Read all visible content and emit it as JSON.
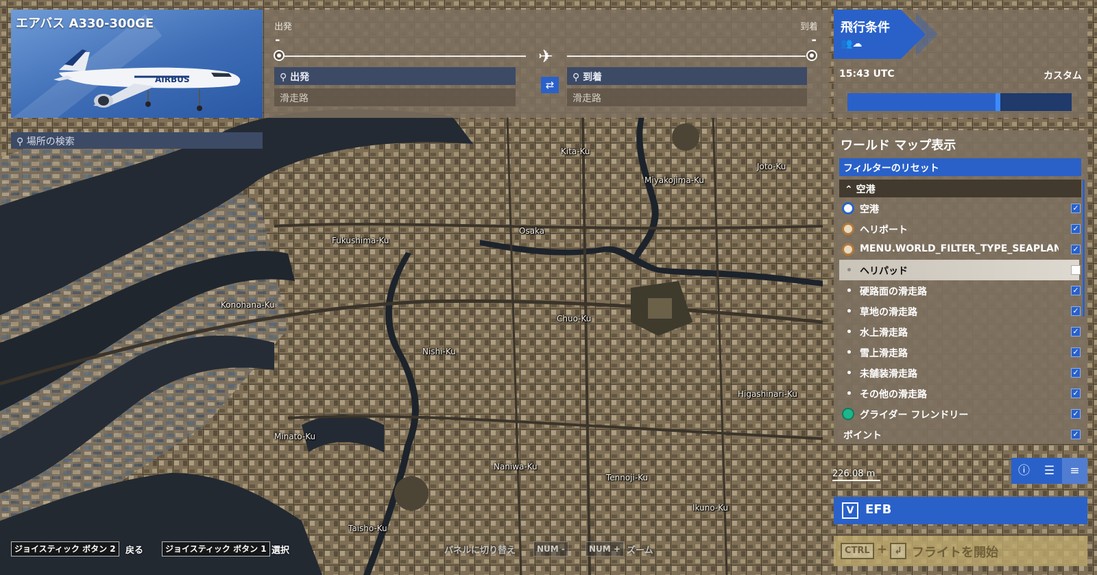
{
  "map": {
    "labels": [
      "Kita-Ku",
      "Joto-Ku",
      "Miyakojima-Ku",
      "Osaka",
      "Fukushima-Ku",
      "Konohana-Ku",
      "Chuo-Ku",
      "Nishi-Ku",
      "Higashinari-Ku",
      "Minato-Ku",
      "Naniwa-Ku",
      "Tennoji-Ku",
      "Ikuno-Ku",
      "Taisho-Ku"
    ],
    "scale": "226.08 m"
  },
  "aircraft": {
    "title": "エアバス A330-300GE"
  },
  "route": {
    "departure_label": "出発",
    "arrival_label": "到着",
    "departure_value": "-",
    "arrival_value": "-",
    "departure_search": "出発",
    "arrival_search": "到着",
    "departure_runway": "滑走路",
    "arrival_runway": "滑走路",
    "swap_icon": "swap-arrows",
    "plane_icon": "airplane"
  },
  "conditions": {
    "title": "飛行条件",
    "icons": "👥☁",
    "time": "15:43 UTC",
    "preset": "カスタム",
    "time_of_day_fraction": 0.66
  },
  "location_search": {
    "placeholder": "場所の検索"
  },
  "filter": {
    "title": "ワールド マップ表示",
    "reset": "フィルターのリセット",
    "group": "空港",
    "items": [
      {
        "label": "空港",
        "icon": "airport-icon",
        "checked": true
      },
      {
        "label": "ヘリポート",
        "icon": "heliport-icon",
        "checked": true
      },
      {
        "label": "MENU.WORLD_FILTER_TYPE_SEAPLANE_BASE",
        "icon": "seaplane-icon",
        "checked": true
      },
      {
        "label": "ヘリパッド",
        "icon": "dot",
        "checked": false,
        "selected": true
      },
      {
        "label": "硬路面の滑走路",
        "icon": "dot",
        "checked": true
      },
      {
        "label": "草地の滑走路",
        "icon": "dot",
        "checked": true
      },
      {
        "label": "水上滑走路",
        "icon": "dot",
        "checked": true
      },
      {
        "label": "雪上滑走路",
        "icon": "dot",
        "checked": true
      },
      {
        "label": "未舗装滑走路",
        "icon": "dot",
        "checked": true
      },
      {
        "label": "その他の滑走路",
        "icon": "dot",
        "checked": true
      },
      {
        "label": "グライダー フレンドリー",
        "icon": "glider-icon",
        "checked": true
      },
      {
        "label": "ポイント",
        "icon": "none",
        "checked": true
      }
    ]
  },
  "tools": {
    "info": "ⓘ",
    "layers": "☰",
    "filters": "≡"
  },
  "efb": {
    "key": "V",
    "label": "EFB"
  },
  "start": {
    "key1": "CTRL",
    "plus": "+",
    "key2": "↲",
    "label": "フライトを開始"
  },
  "bottom": {
    "back_key": "ジョイスティック ボタン 2",
    "back_action": "戻る",
    "select_key": "ジョイスティック ボタン 1",
    "select_action": "選択",
    "panel_action": "パネルに切り替え",
    "zoom_out_key": "NUM -",
    "zoom_in_key": "NUM +",
    "zoom_action": "ズーム"
  },
  "colors": {
    "accent": "#2a61c9",
    "panel": "#7d705f",
    "start": "#beaa6e"
  }
}
